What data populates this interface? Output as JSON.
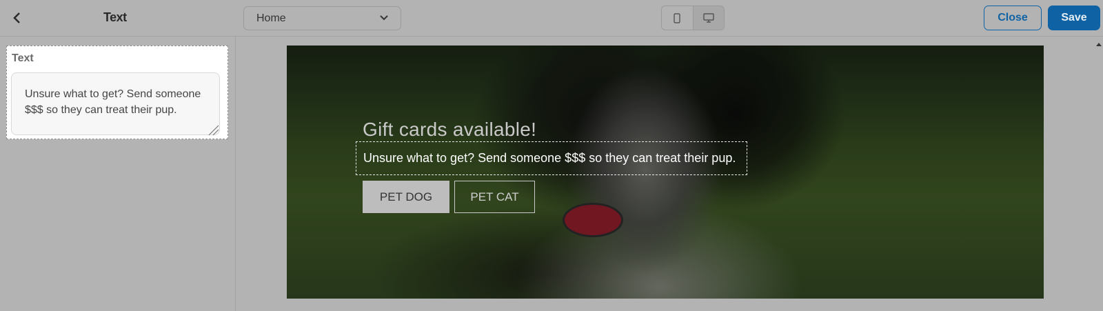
{
  "header": {
    "title": "Text",
    "page_select_value": "Home",
    "close_label": "Close",
    "save_label": "Save"
  },
  "sidebar": {
    "field_label": "Text",
    "field_value": "Unsure what to get? Send someone $$$ so they can treat their pup."
  },
  "preview": {
    "heading": "Gift cards available!",
    "subtext": "Unsure what to get? Send someone $$$ so they can treat their pup.",
    "button_1": "PET DOG",
    "button_2": "PET CAT"
  },
  "colors": {
    "accent": "#0f63a5",
    "background": "#b3b3b3"
  },
  "icons": [
    "chevron-left-icon",
    "chevron-down-icon",
    "mobile-icon",
    "desktop-icon",
    "resize-grip-icon"
  ]
}
